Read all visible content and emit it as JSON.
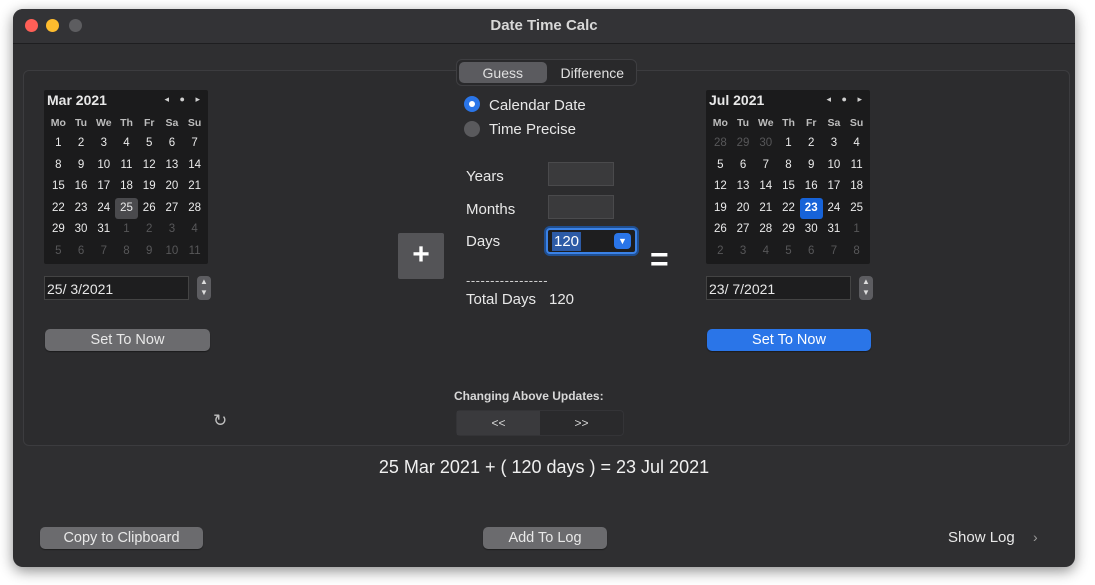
{
  "window": {
    "title": "Date Time Calc"
  },
  "tabs": [
    {
      "label": "Guess",
      "selected": true
    },
    {
      "label": "Difference",
      "selected": false
    }
  ],
  "weekdays": [
    "Mo",
    "Tu",
    "We",
    "Th",
    "Fr",
    "Sa",
    "Su"
  ],
  "left_calendar": {
    "month_label": "Mar 2021",
    "nav": "◂ ● ▸",
    "days": [
      {
        "d": "1",
        "m": false
      },
      {
        "d": "2",
        "m": false
      },
      {
        "d": "3",
        "m": false
      },
      {
        "d": "4",
        "m": false
      },
      {
        "d": "5",
        "m": false
      },
      {
        "d": "6",
        "m": false
      },
      {
        "d": "7",
        "m": false
      },
      {
        "d": "8",
        "m": false
      },
      {
        "d": "9",
        "m": false
      },
      {
        "d": "10",
        "m": false
      },
      {
        "d": "11",
        "m": false
      },
      {
        "d": "12",
        "m": false
      },
      {
        "d": "13",
        "m": false
      },
      {
        "d": "14",
        "m": false
      },
      {
        "d": "15",
        "m": false
      },
      {
        "d": "16",
        "m": false
      },
      {
        "d": "17",
        "m": false
      },
      {
        "d": "18",
        "m": false
      },
      {
        "d": "19",
        "m": false
      },
      {
        "d": "20",
        "m": false
      },
      {
        "d": "21",
        "m": false
      },
      {
        "d": "22",
        "m": false
      },
      {
        "d": "23",
        "m": false
      },
      {
        "d": "24",
        "m": false
      },
      {
        "d": "25",
        "m": false,
        "hl": true
      },
      {
        "d": "26",
        "m": false
      },
      {
        "d": "27",
        "m": false
      },
      {
        "d": "28",
        "m": false
      },
      {
        "d": "29",
        "m": false
      },
      {
        "d": "30",
        "m": false
      },
      {
        "d": "31",
        "m": false
      },
      {
        "d": "1",
        "m": true
      },
      {
        "d": "2",
        "m": true
      },
      {
        "d": "3",
        "m": true
      },
      {
        "d": "4",
        "m": true
      },
      {
        "d": "5",
        "m": true
      },
      {
        "d": "6",
        "m": true
      },
      {
        "d": "7",
        "m": true
      },
      {
        "d": "8",
        "m": true
      },
      {
        "d": "9",
        "m": true
      },
      {
        "d": "10",
        "m": true
      },
      {
        "d": "11",
        "m": true
      }
    ],
    "date_value": "25/  3/2021",
    "set_now_label": "Set To Now"
  },
  "right_calendar": {
    "month_label": "Jul 2021",
    "nav": "◂ ● ▸",
    "days": [
      {
        "d": "28",
        "m": true
      },
      {
        "d": "29",
        "m": true
      },
      {
        "d": "30",
        "m": true
      },
      {
        "d": "1",
        "m": false
      },
      {
        "d": "2",
        "m": false
      },
      {
        "d": "3",
        "m": false
      },
      {
        "d": "4",
        "m": false
      },
      {
        "d": "5",
        "m": false
      },
      {
        "d": "6",
        "m": false
      },
      {
        "d": "7",
        "m": false
      },
      {
        "d": "8",
        "m": false
      },
      {
        "d": "9",
        "m": false
      },
      {
        "d": "10",
        "m": false
      },
      {
        "d": "11",
        "m": false
      },
      {
        "d": "12",
        "m": false
      },
      {
        "d": "13",
        "m": false
      },
      {
        "d": "14",
        "m": false
      },
      {
        "d": "15",
        "m": false
      },
      {
        "d": "16",
        "m": false
      },
      {
        "d": "17",
        "m": false
      },
      {
        "d": "18",
        "m": false
      },
      {
        "d": "19",
        "m": false
      },
      {
        "d": "20",
        "m": false
      },
      {
        "d": "21",
        "m": false
      },
      {
        "d": "22",
        "m": false
      },
      {
        "d": "23",
        "m": false,
        "sel": true
      },
      {
        "d": "24",
        "m": false
      },
      {
        "d": "25",
        "m": false
      },
      {
        "d": "26",
        "m": false
      },
      {
        "d": "27",
        "m": false
      },
      {
        "d": "28",
        "m": false
      },
      {
        "d": "29",
        "m": false
      },
      {
        "d": "30",
        "m": false
      },
      {
        "d": "31",
        "m": false
      },
      {
        "d": "1",
        "m": true
      },
      {
        "d": "2",
        "m": true
      },
      {
        "d": "3",
        "m": true
      },
      {
        "d": "4",
        "m": true
      },
      {
        "d": "5",
        "m": true
      },
      {
        "d": "6",
        "m": true
      },
      {
        "d": "7",
        "m": true
      },
      {
        "d": "8",
        "m": true
      }
    ],
    "date_value": "23/  7/2021",
    "set_now_label": "Set To Now"
  },
  "mode": {
    "calendar_date": "Calendar Date",
    "time_precise": "Time Precise"
  },
  "fields": {
    "years_label": "Years",
    "months_label": "Months",
    "days_label": "Days",
    "years_value": "",
    "months_value": "",
    "days_value": "120"
  },
  "plus_symbol": "+",
  "equals_symbol": "=",
  "divider": "-----------------",
  "total": {
    "label": "Total Days",
    "value": "120"
  },
  "updates": {
    "label": "Changing Above Updates:",
    "left": "<<",
    "right": ">>"
  },
  "reset_icon_glyph": "↻",
  "result_text": "25 Mar 2021 + ( 120 days ) = 23 Jul 2021",
  "footer": {
    "copy_label": "Copy to Clipboard",
    "add_log_label": "Add To Log",
    "show_log_label": "Show Log",
    "chevron": "›"
  },
  "colors": {
    "accent": "#2a75e8",
    "window_bg": "#2f2f31",
    "calendar_bg": "#1b1b1c"
  }
}
